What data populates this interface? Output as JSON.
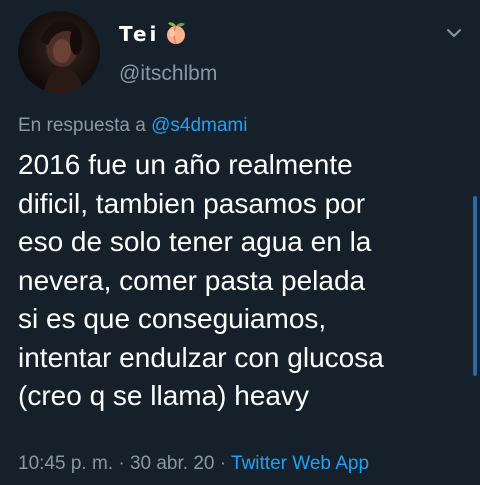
{
  "colors": {
    "background": "#15202b",
    "text_primary": "#ffffff",
    "text_secondary": "#8899a6",
    "accent": "#1da1f2"
  },
  "author": {
    "display_name": "Tei",
    "name_emoji_icon": "peach-icon",
    "handle": "@itschlbm",
    "avatar_icon": "avatar"
  },
  "reply": {
    "prefix": "En respuesta a",
    "mention": "@s4dmami"
  },
  "tweet": {
    "lines": [
      "2016 fue un año realmente",
      "dificil, tambien pasamos por",
      "eso de solo tener agua en la",
      "nevera, comer pasta pelada",
      "si es que conseguiamos,",
      "intentar endulzar con glucosa",
      "(creo q se llama) heavy"
    ]
  },
  "meta": {
    "time": "10:45 p. m.",
    "separator": "·",
    "date": "30 abr. 20",
    "source": "Twitter Web App"
  },
  "menu": {
    "icon": "chevron-down-icon"
  }
}
